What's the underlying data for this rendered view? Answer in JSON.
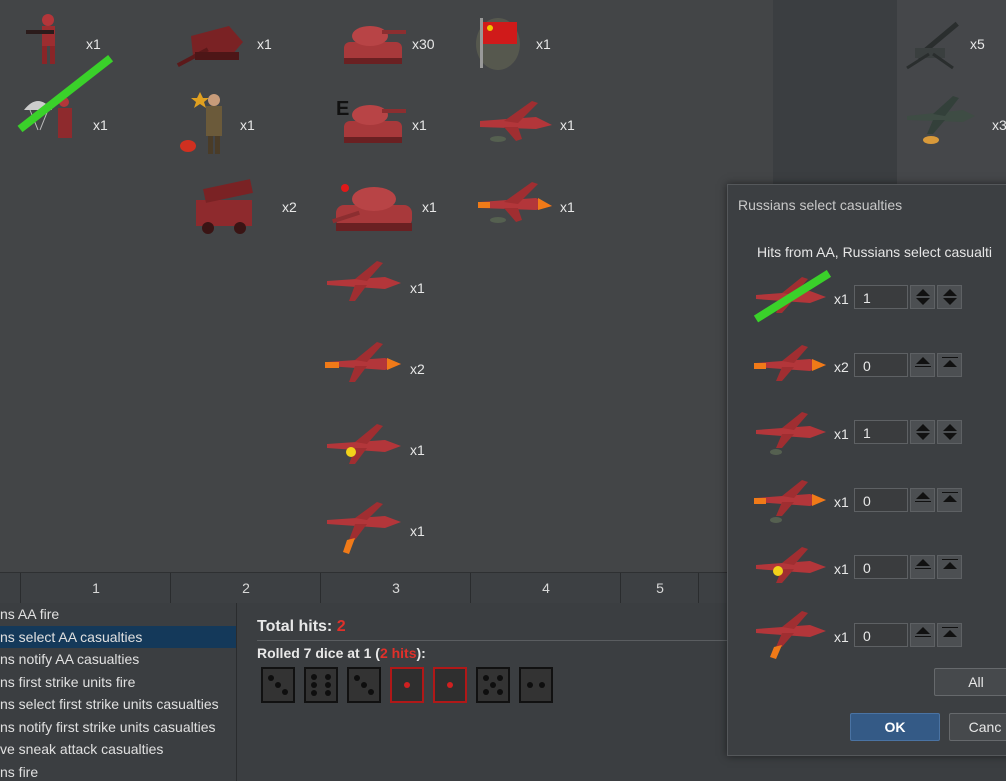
{
  "board": {
    "units": [
      {
        "name": "infantry",
        "count": "x1"
      },
      {
        "name": "tank-destroyer",
        "count": "x1"
      },
      {
        "name": "tank",
        "count": "x30"
      },
      {
        "name": "flag",
        "count": "x1"
      },
      {
        "name": "paratrooper",
        "count": "x1"
      },
      {
        "name": "officer",
        "count": "x1"
      },
      {
        "name": "elite-tank",
        "count": "x1"
      },
      {
        "name": "bomber",
        "count": "x1"
      },
      {
        "name": "rocket-truck",
        "count": "x2"
      },
      {
        "name": "heavy-tank",
        "count": "x1"
      },
      {
        "name": "bomber-orange",
        "count": "x1"
      },
      {
        "name": "fighter",
        "count": "x1"
      },
      {
        "name": "fighter-orange",
        "count": "x2"
      },
      {
        "name": "fighter-yellow",
        "count": "x1"
      },
      {
        "name": "fighter-orange-bomb",
        "count": "x1"
      }
    ],
    "enemy_units": [
      {
        "name": "aa-gun",
        "count": "x5"
      },
      {
        "name": "stuka",
        "count": "x3"
      }
    ],
    "tank_mark": "E"
  },
  "ruler": {
    "labels": [
      "1",
      "2",
      "3",
      "4",
      "5"
    ]
  },
  "steps": [
    "ns AA fire",
    "ns select AA casualties",
    "ns notify AA casualties",
    "ns first strike units fire",
    "ns select first strike units casualties",
    "ns notify first strike units casualties",
    "ve sneak attack casualties",
    "ns fire"
  ],
  "hits": {
    "total_label": "Total hits:",
    "total_value": "2",
    "rolled_prefix": "Rolled 7 dice at 1 (",
    "rolled_hits": "2 hits",
    "rolled_suffix": "):",
    "dice": [
      3,
      6,
      3,
      1,
      1,
      5,
      2
    ],
    "hit_dice": [
      false,
      false,
      false,
      true,
      true,
      false,
      false
    ]
  },
  "dialog": {
    "title": "Russians select casualties",
    "prompt": "Hits from AA,  Russians select  casualti",
    "rows": [
      {
        "count": "x1",
        "value": "1"
      },
      {
        "count": "x2",
        "value": "0"
      },
      {
        "count": "x1",
        "value": "1"
      },
      {
        "count": "x1",
        "value": "0"
      },
      {
        "count": "x1",
        "value": "0"
      },
      {
        "count": "x1",
        "value": "0"
      }
    ],
    "all_label": "All",
    "ok_label": "OK",
    "cancel_label": "Canc"
  },
  "colors": {
    "unit_red": "#b3363a",
    "strike_green": "#3ad12a",
    "hit_red": "#e0302a",
    "select_blue": "#14395a"
  }
}
